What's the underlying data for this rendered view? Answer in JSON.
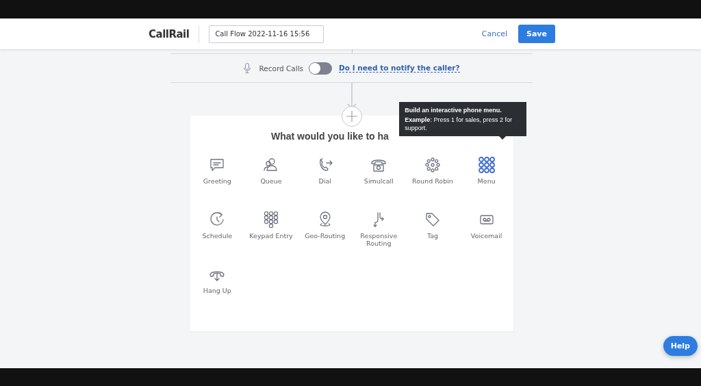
{
  "header": {
    "logo": "CallRail",
    "flow_name": "Call Flow 2022-11-16 15:56",
    "cancel": "Cancel",
    "save": "Save"
  },
  "record": {
    "label": "Record Calls",
    "on": false,
    "link": "Do I need to notify the caller?"
  },
  "picker": {
    "title": "What would you like to ha",
    "tooltip": {
      "heading": "Build an interactive phone menu.",
      "body": "**Example**: Press 1 for sales, press 2 for support."
    },
    "items": [
      {
        "kind": "greeting",
        "label": "Greeting",
        "selected": false
      },
      {
        "kind": "queue",
        "label": "Queue",
        "selected": false
      },
      {
        "kind": "dial",
        "label": "Dial",
        "selected": false
      },
      {
        "kind": "simulcall",
        "label": "Simulcall",
        "selected": false
      },
      {
        "kind": "roundrobin",
        "label": "Round Robin",
        "selected": false
      },
      {
        "kind": "menu",
        "label": "Menu",
        "selected": true
      },
      {
        "kind": "schedule",
        "label": "Schedule",
        "selected": false
      },
      {
        "kind": "keypad",
        "label": "Keypad Entry",
        "selected": false
      },
      {
        "kind": "georouting",
        "label": "Geo-Routing",
        "selected": false
      },
      {
        "kind": "responsive",
        "label": "Responsive Routing",
        "selected": false
      },
      {
        "kind": "tag",
        "label": "Tag",
        "selected": false
      },
      {
        "kind": "voicemail",
        "label": "Voicemail",
        "selected": false
      },
      {
        "kind": "hangup",
        "label": "Hang Up",
        "selected": false
      }
    ]
  },
  "help": "Help"
}
